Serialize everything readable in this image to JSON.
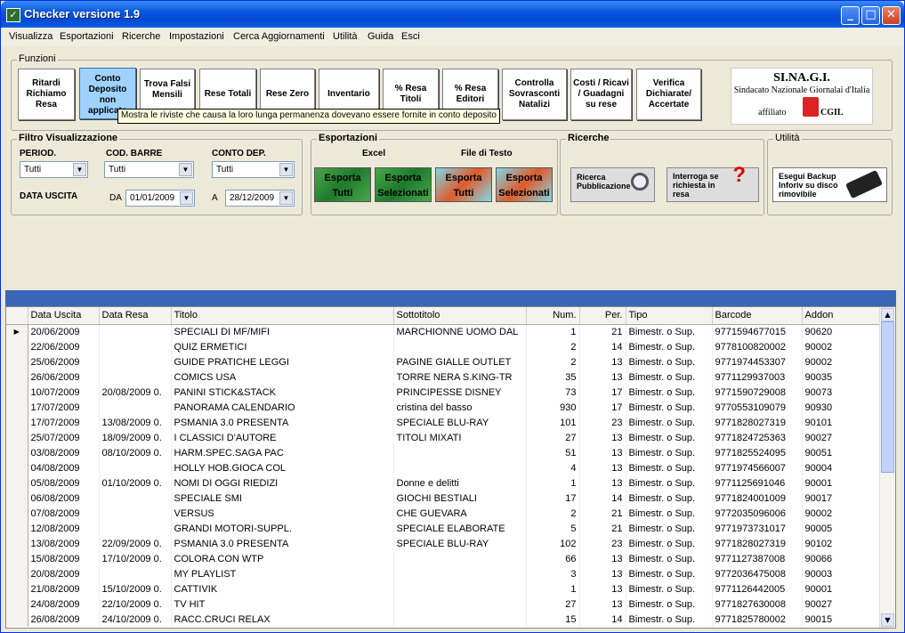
{
  "window": {
    "title": "Checker versione 1.9",
    "minimize": "_",
    "maximize": "□",
    "close": "✕",
    "icon": "app-icon"
  },
  "menu": [
    "Visualizza",
    "Esportazioni",
    "Ricerche",
    "Impostazioni",
    "Cerca Aggiornamenti",
    "Utilità",
    "Guida",
    "Esci"
  ],
  "funzioni": {
    "label": "Funzioni",
    "buttons": [
      "Ritardi Richiamo Resa",
      "Conto Deposito non applicato",
      "Trova Falsi Mensili",
      "Rese Totali",
      "Rese Zero",
      "Inventario",
      "% Resa Titoli",
      "% Resa Editori",
      "Controlla Sovrasconti Natalizi",
      "Costi / Ricavi / Guadagni su rese",
      "Verifica Dichiarate/ Accertate"
    ],
    "tooltip": "Mostra le riviste che causa la loro lunga permanenza dovevano essere fornite in conto deposito"
  },
  "logo": {
    "name": "SI.NA.G.I.",
    "subtitle": "Sindacato Nazionale Giornalai d'Italia",
    "affiliato": "affiliato",
    "union": "CGIL"
  },
  "filtro": {
    "label": "Filtro Visualizzazione",
    "period_label": "PERIOD.",
    "period_value": "Tutti",
    "barcode_label": "COD. BARRE",
    "barcode_value": "Tutti",
    "deposito_label": "CONTO DEP.",
    "deposito_value": "Tutti",
    "data_uscita_label": "DATA USCITA",
    "da_label": "DA",
    "da_value": "01/01/2009",
    "a_label": "A",
    "a_value": "28/12/2009"
  },
  "esportazioni": {
    "label": "Esportazioni",
    "excel_label": "Excel",
    "text_label": "File di Testo",
    "excel_all": "Esporta Tutti",
    "excel_sel": "Esporta Selezionati",
    "text_all": "Esporta Tutti",
    "text_sel": "Esporta Selezionati"
  },
  "ricerche": {
    "label": "Ricerche",
    "ricerca": "Ricerca Pubblicazione",
    "interroga": "Interroga se richiesta in resa"
  },
  "utilita": {
    "label": "Utilità",
    "backup": "Esegui Backup Inforiv su disco rimovibile"
  },
  "table": {
    "columns": [
      "Data Uscita",
      "Data Resa",
      "Titolo",
      "Sottotitolo",
      "Num.",
      "Per.",
      "Tipo",
      "Barcode",
      "Addon"
    ],
    "row_indicator": "▶",
    "rows": [
      [
        "20/06/2009",
        "",
        "SPECIALI DI MF/MIFI",
        "MARCHIONNE UOMO DAL",
        "1",
        "21",
        "Bimestr. o Sup.",
        "9771594677015",
        "90620"
      ],
      [
        "22/06/2009",
        "",
        "QUIZ ERMETICI",
        "",
        "2",
        "14",
        "Bimestr. o Sup.",
        "9778100820002",
        "90002"
      ],
      [
        "25/06/2009",
        "",
        "GUIDE PRATICHE LEGGI",
        "PAGINE GIALLE OUTLET",
        "2",
        "13",
        "Bimestr. o Sup.",
        "9771974453307",
        "90002"
      ],
      [
        "26/06/2009",
        "",
        "COMICS USA",
        "TORRE NERA S.KING-TR",
        "35",
        "13",
        "Bimestr. o Sup.",
        "9771129937003",
        "90035"
      ],
      [
        "10/07/2009",
        "20/08/2009 0.",
        "PANINI STICK&STACK",
        "PRINCIPESSE DISNEY",
        "73",
        "17",
        "Bimestr. o Sup.",
        "9771590729008",
        "90073"
      ],
      [
        "17/07/2009",
        "",
        "PANORAMA CALENDARIO",
        "cristina del basso",
        "930",
        "17",
        "Bimestr. o Sup.",
        "9770553109079",
        "90930"
      ],
      [
        "17/07/2009",
        "13/08/2009 0.",
        "PSMANIA 3.0 PRESENTA",
        "SPECIALE BLU-RAY",
        "101",
        "23",
        "Bimestr. o Sup.",
        "9771828027319",
        "90101"
      ],
      [
        "25/07/2009",
        "18/09/2009 0.",
        "I CLASSICI D'AUTORE",
        "TITOLI MIXATI",
        "27",
        "13",
        "Bimestr. o Sup.",
        "9771824725363",
        "90027"
      ],
      [
        "03/08/2009",
        "08/10/2009 0.",
        "HARM.SPEC.SAGA PAC",
        "",
        "51",
        "13",
        "Bimestr. o Sup.",
        "9771825524095",
        "90051"
      ],
      [
        "04/08/2009",
        "",
        "HOLLY HOB.GIOCA COL",
        "",
        "4",
        "13",
        "Bimestr. o Sup.",
        "9771974566007",
        "90004"
      ],
      [
        "05/08/2009",
        "01/10/2009 0.",
        "NOMI DI OGGI RIEDIZI",
        "Donne e delitti",
        "1",
        "13",
        "Bimestr. o Sup.",
        "9771125691046",
        "90001"
      ],
      [
        "06/08/2009",
        "",
        "SPECIALE SMI",
        "GIOCHI BESTIALI",
        "17",
        "14",
        "Bimestr. o Sup.",
        "9771824001009",
        "90017"
      ],
      [
        "07/08/2009",
        "",
        "VERSUS",
        "CHE GUEVARA",
        "2",
        "21",
        "Bimestr. o Sup.",
        "9772035096006",
        "90002"
      ],
      [
        "12/08/2009",
        "",
        "GRANDI MOTORI-SUPPL.",
        "SPECIALE ELABORATE",
        "5",
        "21",
        "Bimestr. o Sup.",
        "9771973731017",
        "90005"
      ],
      [
        "13/08/2009",
        "22/09/2009 0.",
        "PSMANIA 3.0 PRESENTA",
        "SPECIALE BLU-RAY",
        "102",
        "23",
        "Bimestr. o Sup.",
        "9771828027319",
        "90102"
      ],
      [
        "15/08/2009",
        "17/10/2009 0.",
        "COLORA CON WTP",
        "",
        "66",
        "13",
        "Bimestr. o Sup.",
        "9771127387008",
        "90066"
      ],
      [
        "20/08/2009",
        "",
        "MY PLAYLIST",
        "",
        "3",
        "13",
        "Bimestr. o Sup.",
        "9772036475008",
        "90003"
      ],
      [
        "21/08/2009",
        "15/10/2009 0.",
        "CATTIVIK",
        "",
        "1",
        "13",
        "Bimestr. o Sup.",
        "9771126442005",
        "90001"
      ],
      [
        "24/08/2009",
        "22/10/2009 0.",
        "TV HIT",
        "",
        "27",
        "13",
        "Bimestr. o Sup.",
        "9771827630008",
        "90027"
      ],
      [
        "26/08/2009",
        "24/10/2009 0.",
        "RACC.CRUCI RELAX",
        "",
        "15",
        "14",
        "Bimestr. o Sup.",
        "9771825780002",
        "90015"
      ]
    ]
  }
}
